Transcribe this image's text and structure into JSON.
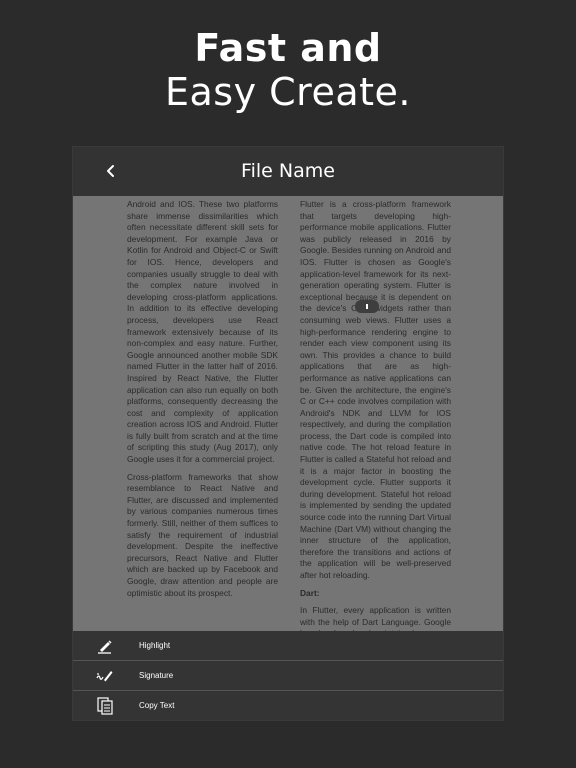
{
  "headline": {
    "line1": "Fast and",
    "line2": "Easy Create."
  },
  "appbar": {
    "title": "File Name",
    "back_icon": "chevron-left-icon"
  },
  "document": {
    "left_column": [
      "Android and IOS. These two platforms share immense dissimilarities which often necessitate different skill sets for development. For example Java or Kotlin for Android and Object-C or Swift for IOS. Hence, developers and companies usually struggle to deal with the complex nature involved in developing cross-platform applications. In addition to its effective developing process, developers use React framework extensively because of its non-complex and easy nature. Further, Google announced another mobile SDK named Flutter in the latter half of 2016. Inspired by React Native, the Flutter application can also run equally on both platforms, consequently decreasing the cost and complexity of application creation across IOS and Android. Flutter is fully built from scratch and at the time of scripting this study (Aug 2017), only Google uses it for a commercial project.",
      "Cross-platform frameworks that show resemblance to React Native and Flutter, are discussed and implemented by various companies numerous times formerly. Still, neither of them suffices to satisfy the requirement of industrial development. Despite the ineffective precursors, React Native and Flutter which are backed up by Facebook and Google, draw attention and people are optimistic about its prospect."
    ],
    "right_column_p1": "Flutter is a cross-platform framework that targets developing high-performance mobile applications. Flutter was publicly released in 2016 by Google. Besides running on Android and IOS. Flutter is chosen as Google's application-level framework for its next-generation operating system. Flutter is exceptional because it is dependent on the device's OEM widgets rather than consuming web views. Flutter uses a high-performance rendering engine to render each view component using its own. This provides a chance to build applications that are as high-performance as native applications can be. Given the architecture, the engine's C or C++ code involves compilation with Android's NDK and LLVM for IOS respectively, and during the compilation process, the Dart code is compiled into native code. The hot reload feature in Flutter is called a Stateful hot reload and it is a major factor in boosting the development cycle. Flutter supports it during development. Stateful hot reload is implemented by sending the updated source code into the running Dart Virtual Machine (Dart VM) without changing the inner structure of the application, therefore the transitions and actions of the application will be well-preserved after hot reloading.",
    "right_subheading": "Dart:",
    "right_column_p2": "In Flutter, every application is written with the help of Dart Language. Google has developed and maintained a"
  },
  "menu": {
    "items": [
      {
        "label": "Highlight",
        "icon": "highlighter-pen-icon"
      },
      {
        "label": "Signature",
        "icon": "signature-pen-icon"
      },
      {
        "label": "Copy Text",
        "icon": "copy-document-icon"
      }
    ]
  },
  "colors": {
    "background": "#2b2b2b",
    "appbar": "#333333",
    "page": "#757575",
    "menu": "#343434",
    "text_light": "#ffffff"
  }
}
